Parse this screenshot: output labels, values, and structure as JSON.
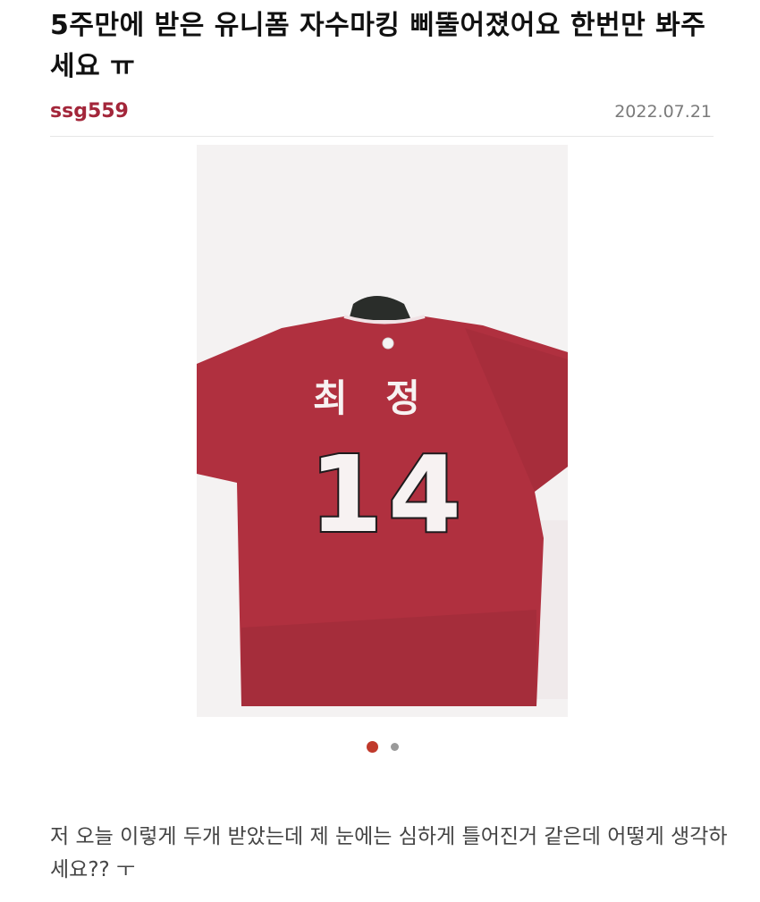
{
  "post": {
    "title": "5주만에 받은 유니폼 자수마킹 삐뚤어졌어요 한번만 봐주세요 ㅠ",
    "author": "ssg559",
    "date": "2022.07.21",
    "body": "저 오늘 이렇게 두개 받았는데 제 눈에는 심하게 틀어진거 같은데 어떻게 생각하세요?? ㅜ"
  },
  "photo": {
    "jersey_name": "최 정",
    "jersey_number": "14",
    "jersey_color": "#b0303f"
  },
  "carousel": {
    "total": 2,
    "active_index": 0,
    "active_color": "#c0392b",
    "inactive_color": "#9a9a9a"
  },
  "colors": {
    "author": "#a3263a",
    "title": "#111111",
    "date": "#7a7a7a",
    "body": "#444444"
  }
}
